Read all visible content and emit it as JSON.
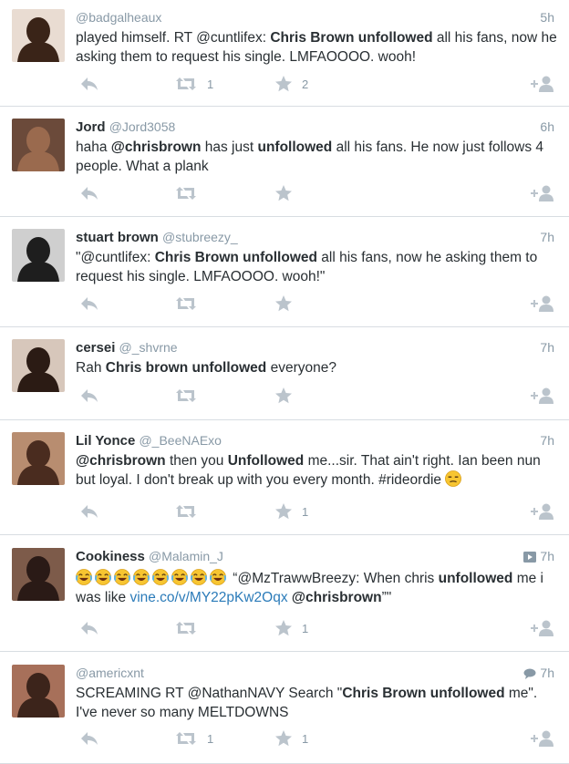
{
  "tweets": [
    {
      "name": "",
      "handle": "@badgalheaux",
      "time": "5h",
      "text": "played himself. RT @cuntlifex: <b>Chris Brown unfollowed</b> all his fans, now he asking them to request his single. LMFAOOOO. wooh!",
      "retweets": "1",
      "favorites": "2",
      "avatar_color": "#3a2418",
      "avatar_bg": "#e9dcd2"
    },
    {
      "name": "Jord",
      "handle": "@Jord3058",
      "time": "6h",
      "text": "haha <b>@chrisbrown</b> has just <b>unfollowed</b> all his fans. He now just follows 4 people. What a plank",
      "retweets": "",
      "favorites": "",
      "avatar_color": "#9a6a4e",
      "avatar_bg": "#6b4a3a"
    },
    {
      "name": "stuart brown",
      "handle": "@stubreezy_",
      "time": "7h",
      "text": "\"@cuntlifex: <b>Chris Brown unfollowed</b> all his fans, now he asking them to request his single. LMFAOOOO. wooh!\"",
      "retweets": "",
      "favorites": "",
      "avatar_color": "#1e1e1e",
      "avatar_bg": "#cfcfcf"
    },
    {
      "name": "cersei",
      "handle": "@_shvrne",
      "time": "7h",
      "text": "Rah <b>Chris brown unfollowed</b> everyone?",
      "retweets": "",
      "favorites": "",
      "avatar_color": "#2b1b14",
      "avatar_bg": "#d7c7bb"
    },
    {
      "name": "Lil Yonce",
      "handle": "@_BeeNAExo",
      "time": "7h",
      "text": "<b>@chrisbrown</b> then you <b>Unfollowed</b> me...sir. That ain't right. Ian been nun but loyal. I don't break up with you every month. #rideordie",
      "text_emoji": "unamused-emoji",
      "retweets": "",
      "favorites": "1",
      "avatar_color": "#4a2c1f",
      "avatar_bg": "#b88d70"
    },
    {
      "name": "Cookiness",
      "handle": "@Malamin_J",
      "time": "7h",
      "time_icon": "media-icon",
      "emoji_prefix_count": 8,
      "emoji_name": "joy-emoji",
      "text": "“@MzTrawwBreezy: When chris <b>unfollowed</b> me i was like <span class=\"link\">vine.co/v/MY22pKw2Oqx</span> <b>@chrisbrown</b>”\"",
      "retweets": "",
      "favorites": "1",
      "avatar_color": "#2a1a16",
      "avatar_bg": "#7d5b4a"
    },
    {
      "name": "",
      "handle": "@americxnt",
      "time": "7h",
      "time_icon": "conversation-icon",
      "text": "SCREAMING RT @NathanNAVY Search \"<b>Chris Brown unfollowed</b> me\". I've never so many MELTDOWNS",
      "retweets": "1",
      "favorites": "1",
      "avatar_color": "#3c241b",
      "avatar_bg": "#a7705a"
    }
  ],
  "icons": {
    "reply": "reply-icon",
    "retweet": "retweet-icon",
    "favorite": "star-icon",
    "follow": "follow-user-icon"
  },
  "colors": {
    "name": "#292f33",
    "muted": "#8899a6",
    "link": "#2b7bb9",
    "action_icon": "#bbc4cc",
    "divider": "#d8dde2"
  }
}
